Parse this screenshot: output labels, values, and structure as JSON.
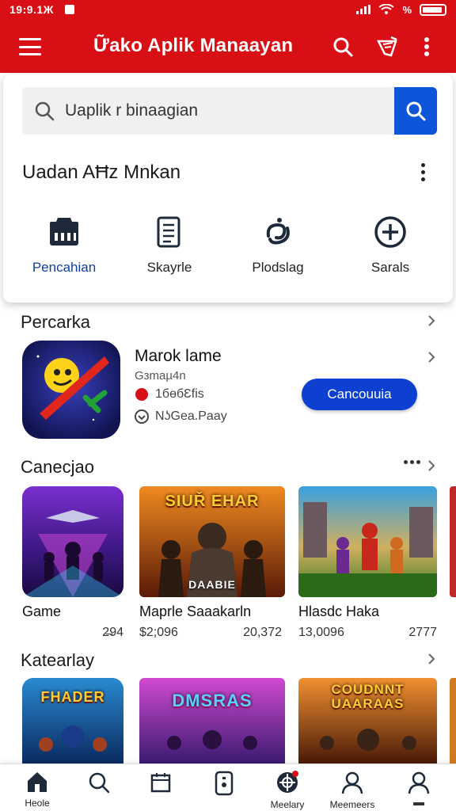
{
  "status_bar": {
    "time": "19:9.1Ж"
  },
  "app_bar": {
    "title": "Ữako Aplik Manaayan",
    "icons": [
      "menu-icon",
      "search-icon",
      "gift-icon",
      "more-vert-icon"
    ]
  },
  "search": {
    "placeholder": "Uaplik r binaagian"
  },
  "card": {
    "title": "Uadan AĦz Mnkan",
    "actions": [
      {
        "label": "Pencahian",
        "icon": "store-icon",
        "active": true
      },
      {
        "label": "Skayrle",
        "icon": "list-doc-icon",
        "active": false
      },
      {
        "label": "Plodslag",
        "icon": "swirl-icon",
        "active": false
      },
      {
        "label": "Sarals",
        "icon": "plus-circle-icon",
        "active": false
      }
    ]
  },
  "featured": {
    "section_title": "Percarka",
    "name": "Marok lame",
    "category": "Gзmaµ4n",
    "stat1": "1бөбƐfis",
    "stat2": "NʖGea.Paay",
    "button_label": "Cancouuia"
  },
  "section2": {
    "title": "Canecjao",
    "items": [
      {
        "name": "Game",
        "meta_left": "",
        "meta_right": "2̶94",
        "art_text": ""
      },
      {
        "name": "Maprle Saaakarln",
        "meta_left": "$2;096",
        "meta_right": "20,372",
        "art_text": "SIUŘ EHAR",
        "art_sub": "DAABIE"
      },
      {
        "name": "Hlasdc Haka",
        "meta_left": "13,0096",
        "meta_right": "2777",
        "art_text": ""
      }
    ]
  },
  "section3": {
    "title": "Katearlay",
    "items": [
      {
        "art_text": "FHADER"
      },
      {
        "art_text": "DMSRAS"
      },
      {
        "art_text": "COUDNNT UAARAAS"
      }
    ]
  },
  "bottom_nav": [
    {
      "label": "Heole",
      "icon": "home-icon"
    },
    {
      "label": "",
      "icon": "search-icon"
    },
    {
      "label": "",
      "icon": "calendar-icon"
    },
    {
      "label": "",
      "icon": "device-icon"
    },
    {
      "label": "Meelary",
      "icon": "globe-icon"
    },
    {
      "label": "Meemeers",
      "icon": "person-icon"
    },
    {
      "label": "",
      "icon": "account-icon"
    }
  ],
  "colors": {
    "brand": "#d90f16",
    "accent": "#0d55d9",
    "button": "#0d3fd0"
  }
}
